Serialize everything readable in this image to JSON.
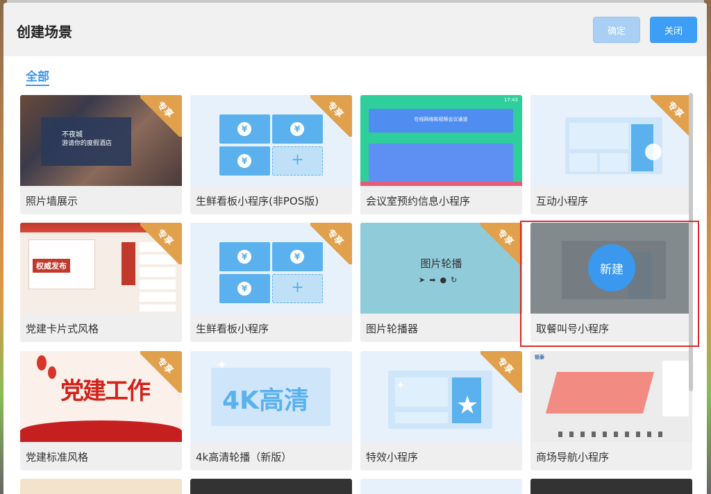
{
  "dialog": {
    "title": "创建场景",
    "confirm_label": "确定",
    "close_label": "关闭"
  },
  "tabs": {
    "all_label": "全部"
  },
  "badge_label": "专享",
  "cards": [
    {
      "label": "照片墙展示",
      "exclusive": true,
      "thumb_text": [
        "不夜城",
        "游请你的度假酒店"
      ]
    },
    {
      "label": "生鲜看板小程序(非POS版)",
      "exclusive": true
    },
    {
      "label": "会议室预约信息小程序",
      "exclusive": false,
      "thumb_text": [
        "17:43",
        "在线网络和视频会议通道"
      ]
    },
    {
      "label": "互动小程序",
      "exclusive": true
    },
    {
      "label": "党建卡片式风格",
      "exclusive": true,
      "thumb_text": [
        "权威发布"
      ]
    },
    {
      "label": "生鲜看板小程序",
      "exclusive": true
    },
    {
      "label": "图片轮播器",
      "exclusive": true,
      "thumb_text": [
        "图片轮播"
      ]
    },
    {
      "label": "取餐叫号小程序",
      "exclusive": false,
      "hover_action": "新建"
    },
    {
      "label": "党建标准风格",
      "exclusive": true,
      "thumb_text": [
        "党建工作"
      ]
    },
    {
      "label": "4k高清轮播（新版）",
      "exclusive": false,
      "thumb_text": [
        "4K高清"
      ]
    },
    {
      "label": "特效小程序",
      "exclusive": true
    },
    {
      "label": "商场导航小程序",
      "exclusive": false,
      "thumb_text": [
        "银泰"
      ]
    }
  ],
  "icons": [
    "yen-icon",
    "plus-icon",
    "hand-pointer-icon",
    "send-icon",
    "arrow-icon",
    "dot-icon",
    "refresh-icon",
    "sparkle-icon",
    "star-icon"
  ],
  "colors": {
    "accent": "#3c9ef5",
    "badge": "#e0a04c",
    "highlight": "#d92a2a"
  }
}
